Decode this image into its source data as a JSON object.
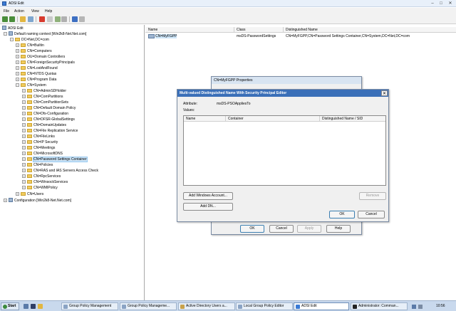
{
  "window": {
    "title": "ADSI Edit",
    "minimize": "–",
    "maximize": "□",
    "close": "✕"
  },
  "menu": [
    "File",
    "Action",
    "View",
    "Help"
  ],
  "tree": {
    "root": "ADSI Edit",
    "context": "Default naming context [Win2k8-Net.Net.com]",
    "domain": "DC=Net,DC=com",
    "domain_children": [
      "CN=Builtin",
      "CN=Computers",
      "OU=Domain Controllers",
      "CN=ForeignSecurityPrincipals",
      "CN=LostAndFound",
      "CN=NTDS Quotas",
      "CN=Program Data"
    ],
    "system": "CN=System",
    "system_children": [
      "CN=AdminSDHolder",
      "CN=ComPartitions",
      "CN=ComPartitionSets",
      "CN=Default Domain Policy",
      "CN=Dfs-Configuration",
      "CN=DFSR-GlobalSettings",
      "CN=DomainUpdates",
      "CN=File Replication Service",
      "CN=FileLinks",
      "CN=IP Security",
      "CN=Meetings",
      "CN=MicrosoftDNS",
      "CN=Password Settings Container",
      "CN=Policies",
      "CN=RAS and IAS Servers Access Check",
      "CN=RpcServices",
      "CN=WinsockServices",
      "CN=WMIPolicy"
    ],
    "users": "CN=Users",
    "configuration": "Configuration [Win2k8-Net.Net.com]"
  },
  "list": {
    "headers": [
      "Name",
      "Class",
      "Distinguished Name"
    ],
    "rows": [
      {
        "name": "CN=MyFGPP",
        "class": "msDS-PasswordSettings",
        "dn": "CN=MyFGPP,CN=Password Settings Container,CN=System,DC=Net,DC=com"
      }
    ]
  },
  "properties_dialog": {
    "title": "CN=MyFGPP Properties",
    "ok": "OK",
    "cancel": "Cancel",
    "apply": "Apply",
    "help": "Help"
  },
  "editor_dialog": {
    "title": "Multi-valued Distinguished Name With Security Principal Editor",
    "close": "✕",
    "attribute_label": "Attribute:",
    "attribute_value": "msDS-PSOAppliesTo",
    "values_label": "Values:",
    "columns": [
      "Name",
      "Container",
      "Distinguished Name / SID"
    ],
    "add_windows_account": "Add Windows Account...",
    "add_dn": "Add DN...",
    "remove": "Remove",
    "ok": "OK",
    "cancel": "Cancel"
  },
  "taskbar": {
    "start": "Start",
    "buttons": [
      "Group Policy Management",
      "Group Policy Manageme...",
      "Active Directory Users a...",
      "Local Group Policy Editor",
      "ADSI Edit",
      "Administrator: Comman..."
    ],
    "clock": "10:56 PM"
  },
  "colors": {
    "selection": "#cce4f7",
    "folder": "#f2cc5f",
    "accent": "#3a7bd5"
  }
}
